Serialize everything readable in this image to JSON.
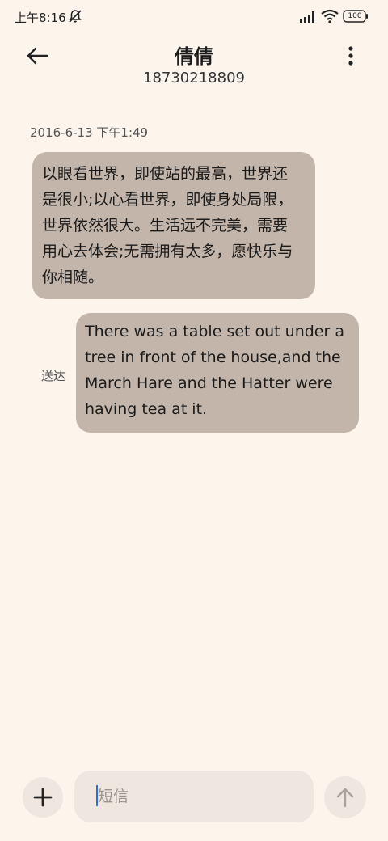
{
  "status_bar": {
    "time": "上午8:16",
    "battery": "100",
    "icons": [
      "mute-icon",
      "signal-icon",
      "wifi-icon",
      "battery-icon"
    ]
  },
  "header": {
    "contact_name": "倩倩",
    "contact_number": "18730218809",
    "icons": [
      "arrow-left-icon",
      "more-vertical-icon"
    ]
  },
  "conversation": {
    "timestamp": "2016-6-13 下午1:49",
    "messages": [
      {
        "direction": "incoming",
        "lines": [
          "以眼看世界，即使站的最高，世界还",
          "是很小;以心看世界，即使身处局限，",
          "世界依然很大。生活远不完美，需要",
          "用心去体会;无需拥有太多，愿快乐与",
          "你相随。"
        ]
      },
      {
        "direction": "outgoing",
        "lines": [
          "There was a table set out under a",
          "tree in front of the house,and the",
          "March Hare and the Hatter were",
          "having tea at it."
        ],
        "status": "送达"
      }
    ]
  },
  "composer": {
    "placeholder": "短信",
    "value": "",
    "icons": [
      "plus-icon",
      "send-arrow-up-icon"
    ]
  },
  "colors": {
    "background": "#fdf4ec",
    "bubble": "#c3b5a9",
    "control_bg": "#efe6df",
    "cursor": "#2d6de0"
  }
}
